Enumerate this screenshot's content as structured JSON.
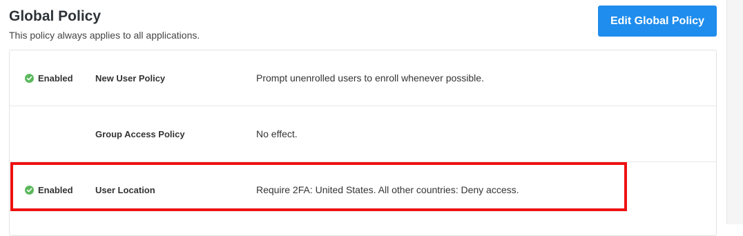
{
  "header": {
    "title": "Global Policy",
    "subtitle": "This policy always applies to all applications.",
    "edit_button_label": "Edit Global Policy"
  },
  "policies": [
    {
      "status": "Enabled",
      "name": "New User Policy",
      "description": "Prompt unenrolled users to enroll whenever possible."
    },
    {
      "status": "",
      "name": "Group Access Policy",
      "description": "No effect."
    },
    {
      "status": "Enabled",
      "name": "User Location",
      "description": "Require 2FA: United States. All other countries: Deny access."
    }
  ],
  "colors": {
    "accent": "#1f8ded",
    "enabled": "#5cb85c",
    "highlight": "#ee1111"
  }
}
